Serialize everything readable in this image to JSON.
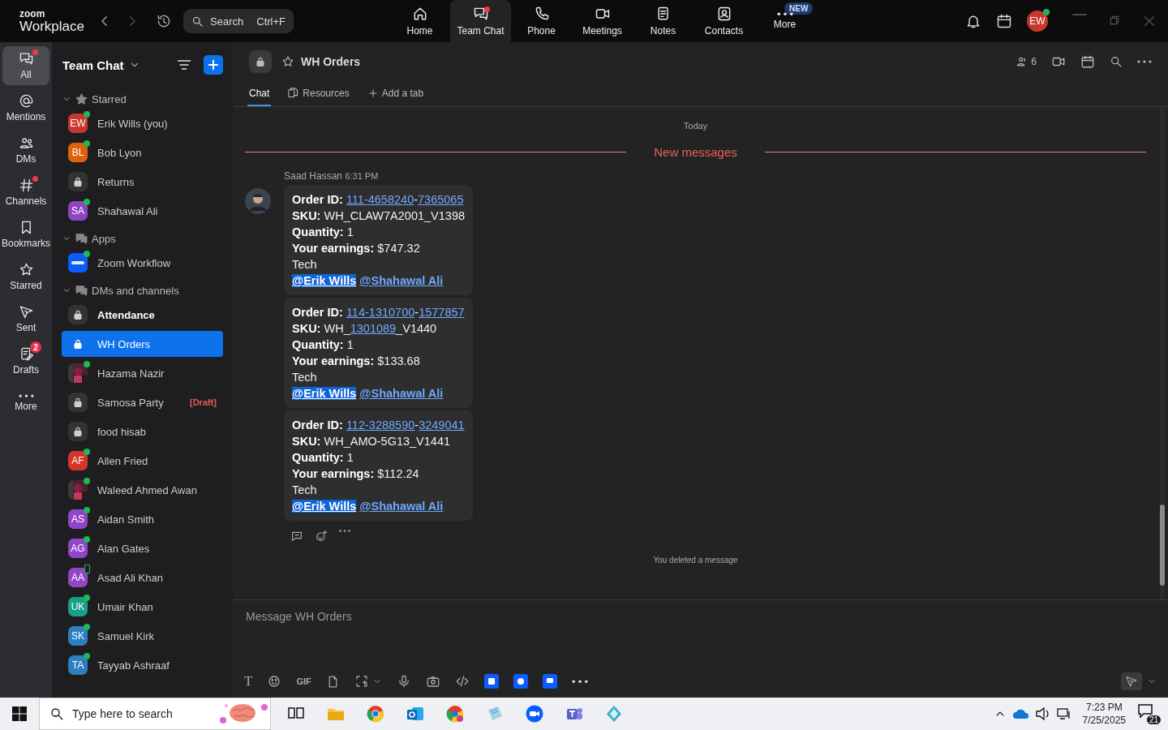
{
  "app": {
    "logo_top": "zoom",
    "logo_bottom": "Workplace"
  },
  "search": {
    "placeholder": "Search",
    "shortcut": "Ctrl+F"
  },
  "nav": [
    {
      "label": "Home",
      "selected": false,
      "dot": false
    },
    {
      "label": "Team Chat",
      "selected": true,
      "dot": true
    },
    {
      "label": "Phone",
      "selected": false,
      "dot": false
    },
    {
      "label": "Meetings",
      "selected": false,
      "dot": false
    },
    {
      "label": "Notes",
      "selected": false,
      "dot": false
    },
    {
      "label": "Contacts",
      "selected": false,
      "dot": false
    },
    {
      "label": "More",
      "selected": false,
      "dot": false,
      "badge": "NEW"
    }
  ],
  "profile": {
    "initials": "EW",
    "online": true
  },
  "rail": [
    {
      "label": "All",
      "selected": true,
      "dot": true
    },
    {
      "label": "Mentions",
      "selected": false,
      "dot": false
    },
    {
      "label": "DMs",
      "selected": false,
      "dot": false
    },
    {
      "label": "Channels",
      "selected": false,
      "dot": true
    },
    {
      "label": "Bookmarks",
      "selected": false,
      "dot": false
    },
    {
      "label": "Starred",
      "selected": false,
      "dot": false
    },
    {
      "label": "Sent",
      "selected": false,
      "dot": false
    },
    {
      "label": "Drafts",
      "selected": false,
      "dot": false,
      "count": "2"
    },
    {
      "label": "More",
      "selected": false,
      "dot": false
    }
  ],
  "sidebar": {
    "title": "Team Chat",
    "sections": [
      {
        "title": "Starred",
        "expanded": true,
        "items": [
          {
            "name": "Erik Wills (you)",
            "kind": "avatar",
            "initials": "EW",
            "color": "#c8372d",
            "online": true,
            "mobile": false,
            "bold": false,
            "selected": false
          },
          {
            "name": "Bob Lyon",
            "kind": "avatar",
            "initials": "BL",
            "color": "#e0620d",
            "online": true,
            "mobile": false,
            "bold": false,
            "selected": false
          },
          {
            "name": "Returns",
            "kind": "channel",
            "online": false,
            "mobile": false,
            "bold": false,
            "selected": false
          },
          {
            "name": "Shahawal Ali",
            "kind": "avatar",
            "initials": "SA",
            "color": "#9044c4",
            "online": true,
            "mobile": false,
            "bold": false,
            "selected": false
          }
        ]
      },
      {
        "title": "Apps",
        "expanded": true,
        "items": [
          {
            "name": "Zoom Workflow",
            "kind": "app",
            "online": true,
            "mobile": false,
            "bold": false,
            "selected": false
          }
        ]
      },
      {
        "title": "DMs and channels",
        "expanded": true,
        "items": [
          {
            "name": "Attendance",
            "kind": "channel",
            "online": false,
            "mobile": false,
            "bold": true,
            "selected": false
          },
          {
            "name": "WH Orders",
            "kind": "channel",
            "online": false,
            "mobile": false,
            "bold": false,
            "selected": true
          },
          {
            "name": "Hazama Nazir",
            "online": true,
            "mobile": false,
            "bold": false,
            "selected": false
          },
          {
            "name": "Samosa Party",
            "kind": "channel",
            "online": false,
            "mobile": false,
            "bold": false,
            "selected": false,
            "tag": "[Draft]"
          },
          {
            "name": "food hisab",
            "kind": "channel",
            "online": false,
            "mobile": false,
            "bold": false,
            "selected": false
          },
          {
            "name": "Allen Fried",
            "kind": "avatar",
            "initials": "AF",
            "color": "#d2352b",
            "online": true,
            "mobile": false,
            "bold": false,
            "selected": false
          },
          {
            "name": "Waleed Ahmed Awan",
            "online": true,
            "mobile": false,
            "bold": false,
            "selected": false
          },
          {
            "name": "Aidan Smith",
            "kind": "avatar",
            "initials": "AS",
            "color": "#9146c9",
            "online": true,
            "mobile": false,
            "bold": false,
            "selected": false
          },
          {
            "name": "Alan Gates",
            "kind": "avatar",
            "initials": "AG",
            "color": "#9146c9",
            "online": true,
            "mobile": false,
            "bold": false,
            "selected": false
          },
          {
            "name": "Asad Ali Khan",
            "kind": "avatar",
            "initials": "AA",
            "color": "#9146c9",
            "online": false,
            "mobile": true,
            "bold": false,
            "selected": false
          },
          {
            "name": "Umair Khan",
            "kind": "avatar",
            "initials": "UK",
            "color": "#17a087",
            "online": true,
            "mobile": false,
            "bold": false,
            "selected": false
          },
          {
            "name": "Samuel Kirk",
            "kind": "avatar",
            "initials": "SK",
            "color": "#2d7fc1",
            "online": true,
            "mobile": false,
            "bold": false,
            "selected": false
          },
          {
            "name": "Tayyab Ashraaf",
            "kind": "avatar",
            "initials": "TA",
            "color": "#2d7fc1",
            "online": true,
            "mobile": false,
            "bold": false,
            "selected": false
          }
        ]
      }
    ]
  },
  "chat": {
    "title": "WH Orders",
    "members": "6",
    "tabs": [
      {
        "label": "Chat",
        "selected": true
      },
      {
        "label": "Resources",
        "selected": false
      }
    ],
    "add_tab": "Add a tab",
    "day": "Today",
    "new_marker": "New messages",
    "message": {
      "sender": "Saad Hassan",
      "time": "6:31 PM",
      "bubbles": [
        {
          "lines": [
            {
              "kind": "field",
              "label": "Order ID:",
              "parts": [
                {
                  "text": "111-4658240",
                  "link": true
                },
                {
                  "text": "-",
                  "link": false
                },
                {
                  "text": "7365065",
                  "link": true
                }
              ]
            },
            {
              "kind": "field",
              "label": "SKU:",
              "parts": [
                {
                  "text": "WH_CLAW7A2001_V1398",
                  "link": false
                }
              ]
            },
            {
              "kind": "field",
              "label": "Quantity:",
              "parts": [
                {
                  "text": "1",
                  "link": false
                }
              ]
            },
            {
              "kind": "field",
              "label": "Your earnings:",
              "parts": [
                {
                  "text": "$747.32",
                  "link": false
                }
              ]
            },
            {
              "kind": "text",
              "text": "Tech"
            },
            {
              "kind": "mentions",
              "mentions": [
                {
                  "text": "@Erik Wills",
                  "self": true
                },
                {
                  "text": "@Shahawal Ali",
                  "self": false
                }
              ]
            }
          ]
        },
        {
          "lines": [
            {
              "kind": "field",
              "label": "Order ID:",
              "parts": [
                {
                  "text": "114-1310700",
                  "link": true
                },
                {
                  "text": "-",
                  "link": false
                },
                {
                  "text": "1577857",
                  "link": true
                }
              ]
            },
            {
              "kind": "field",
              "label": "SKU:",
              "parts": [
                {
                  "text": "WH_",
                  "link": false
                },
                {
                  "text": "1301089",
                  "link": true
                },
                {
                  "text": "_V1440",
                  "link": false
                }
              ]
            },
            {
              "kind": "field",
              "label": "Quantity:",
              "parts": [
                {
                  "text": "1",
                  "link": false
                }
              ]
            },
            {
              "kind": "field",
              "label": "Your earnings:",
              "parts": [
                {
                  "text": "$133.68",
                  "link": false
                }
              ]
            },
            {
              "kind": "text",
              "text": "Tech"
            },
            {
              "kind": "mentions",
              "mentions": [
                {
                  "text": "@Erik Wills",
                  "self": true
                },
                {
                  "text": "@Shahawal Ali",
                  "self": false
                }
              ]
            }
          ]
        },
        {
          "lines": [
            {
              "kind": "field",
              "label": "Order ID:",
              "parts": [
                {
                  "text": "112-3288590",
                  "link": true
                },
                {
                  "text": "-",
                  "link": false
                },
                {
                  "text": "3249041",
                  "link": true
                }
              ]
            },
            {
              "kind": "field",
              "label": "SKU:",
              "parts": [
                {
                  "text": "WH_AMO-5G13_V1441",
                  "link": false
                }
              ]
            },
            {
              "kind": "field",
              "label": "Quantity:",
              "parts": [
                {
                  "text": "1",
                  "link": false
                }
              ]
            },
            {
              "kind": "field",
              "label": "Your earnings:",
              "parts": [
                {
                  "text": "$112.24",
                  "link": false
                }
              ]
            },
            {
              "kind": "text",
              "text": "Tech"
            },
            {
              "kind": "mentions",
              "mentions": [
                {
                  "text": "@Erik Wills",
                  "self": true
                },
                {
                  "text": "@Shahawal Ali",
                  "self": false
                }
              ]
            }
          ]
        }
      ]
    },
    "system_note": "You deleted a message",
    "composer": {
      "placeholder": "Message WH Orders",
      "format_label": "T",
      "gif_label": "GIF"
    }
  },
  "taskbar": {
    "search_placeholder": "Type here to search",
    "time": "7:23 PM",
    "date": "7/25/2025",
    "notifications": "21"
  }
}
